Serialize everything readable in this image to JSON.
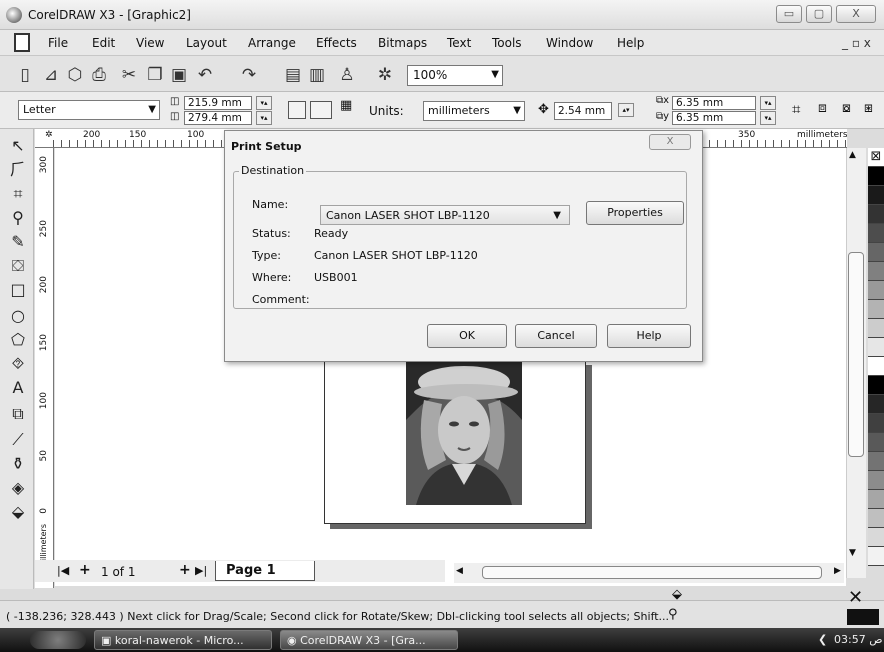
{
  "window": {
    "title": "CorelDRAW X3 - [Graphic2]",
    "min": "▭",
    "max": "▢",
    "close": "X"
  },
  "menu": {
    "items": [
      "File",
      "Edit",
      "View",
      "Layout",
      "Arrange",
      "Effects",
      "Bitmaps",
      "Text",
      "Tools",
      "Window",
      "Help"
    ],
    "doc_controls": "_ ▫ x"
  },
  "toolbar": {
    "zoom": "100%"
  },
  "propbar": {
    "paper": "Letter",
    "width": "215.9 mm",
    "height": "279.4 mm",
    "units_label": "Units:",
    "units_value": "millimeters",
    "nudge": "2.54 mm",
    "dup_x": "6.35 mm",
    "dup_y": "6.35 mm"
  },
  "ruler": {
    "top_marks": [
      "200",
      "150",
      "100",
      "350"
    ],
    "units": "millimeters",
    "left_marks": [
      "300",
      "250",
      "200",
      "150",
      "100",
      "50",
      "0"
    ],
    "left_units": "millimeters"
  },
  "page_nav": {
    "count": "1 of 1",
    "tab": "Page 1"
  },
  "status": {
    "text": "( -138.236; 328.443 )  Next click for Drag/Scale; Second click for Rotate/Skew; Dbl-clicking tool selects all objects; Shift..."
  },
  "taskbar": {
    "task1": "koral-nawerok - Micro...",
    "task2": "CorelDRAW X3 - [Gra...",
    "clock": "03:57 ص"
  },
  "dialog": {
    "title": "Print Setup",
    "group": "Destination",
    "name_label": "Name:",
    "name_value": "Canon LASER SHOT LBP-1120",
    "status_label": "Status:",
    "status_value": "Ready",
    "type_label": "Type:",
    "type_value": "Canon LASER SHOT LBP-1120",
    "where_label": "Where:",
    "where_value": "USB001",
    "comment_label": "Comment:",
    "comment_value": "",
    "properties": "Properties",
    "ok": "OK",
    "cancel": "Cancel",
    "help": "Help",
    "close": "X"
  },
  "palette": [
    "#ffffff",
    "#000000",
    "#1a1a1a",
    "#333333",
    "#4d4d4d",
    "#666666",
    "#808080",
    "#999999",
    "#b3b3b3",
    "#cccccc",
    "#e6e6e6",
    "#ffffff",
    "#000000",
    "#262626",
    "#404040",
    "#595959",
    "#737373",
    "#8c8c8c",
    "#a6a6a6",
    "#bfbfbf",
    "#d9d9d9",
    "#f2f2f2"
  ]
}
